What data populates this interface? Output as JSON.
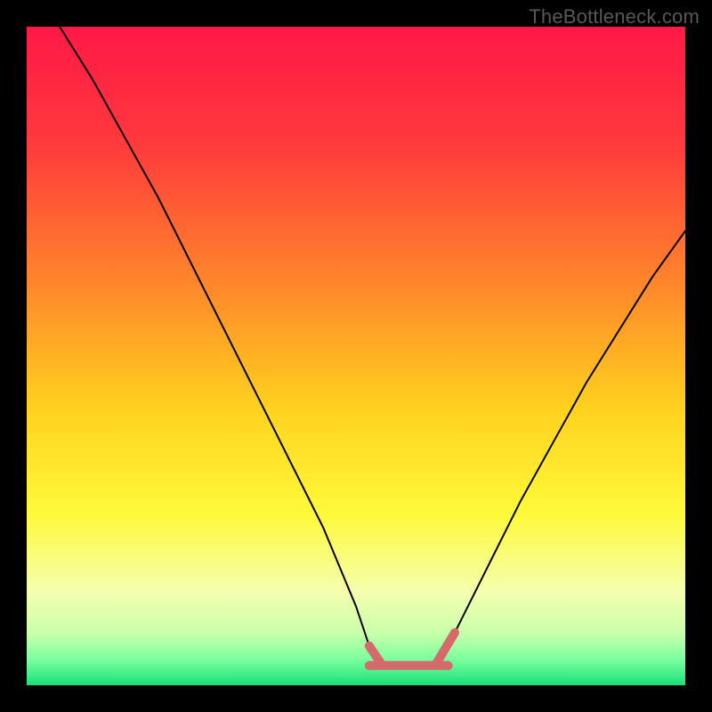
{
  "watermark": "TheBottleneck.com",
  "chart_data": {
    "type": "line",
    "title": "",
    "xlabel": "",
    "ylabel": "",
    "xlim": [
      0,
      100
    ],
    "ylim": [
      0,
      100
    ],
    "gradient_stops": [
      {
        "offset": 0,
        "color": "#ff1846"
      },
      {
        "offset": 0.18,
        "color": "#ff3a3c"
      },
      {
        "offset": 0.4,
        "color": "#ff8a2a"
      },
      {
        "offset": 0.58,
        "color": "#ffd21f"
      },
      {
        "offset": 0.74,
        "color": "#fff93a"
      },
      {
        "offset": 0.86,
        "color": "#f4ffb0"
      },
      {
        "offset": 0.92,
        "color": "#c9ffaa"
      },
      {
        "offset": 0.96,
        "color": "#7dff9e"
      },
      {
        "offset": 1.0,
        "color": "#19e07a"
      }
    ],
    "plateau": {
      "x_start": 52,
      "x_end": 64,
      "y": 3,
      "color": "#d46a6a",
      "stroke_width": 10
    },
    "series": [
      {
        "name": "left-curve",
        "color": "#000000",
        "stroke_width": 2,
        "x": [
          5,
          10,
          15,
          20,
          25,
          30,
          35,
          40,
          45,
          50,
          52,
          54
        ],
        "y": [
          100,
          92,
          83,
          74,
          64,
          54,
          44,
          34,
          24,
          12,
          6,
          3
        ]
      },
      {
        "name": "right-curve",
        "color": "#000000",
        "stroke_width": 2,
        "x": [
          62,
          65,
          70,
          75,
          80,
          85,
          90,
          95,
          100
        ],
        "y": [
          3,
          8,
          18,
          28,
          37,
          46,
          54,
          62,
          69
        ]
      }
    ]
  }
}
